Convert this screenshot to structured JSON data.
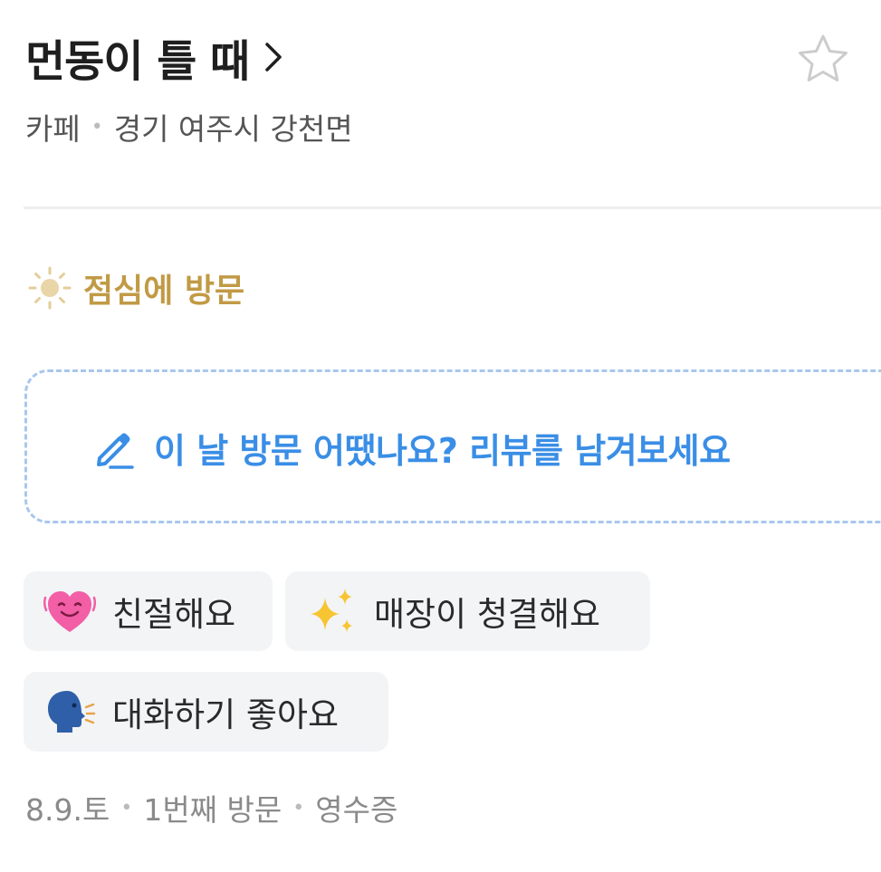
{
  "place": {
    "name": "먼동이 틀 때",
    "category": "카페",
    "address": "경기 여주시 강천면"
  },
  "visit": {
    "time_label": "점심에 방문",
    "time_icon": "sun-icon"
  },
  "review_prompt": {
    "text": "이 날 방문 어땠나요? 리뷰를 남겨보세요",
    "icon": "pencil-icon"
  },
  "keywords": [
    {
      "emoji": "smiling-heart-icon",
      "label": "친절해요"
    },
    {
      "emoji": "sparkles-icon",
      "label": "매장이 청결해요"
    },
    {
      "emoji": "speaking-head-icon",
      "label": "대화하기 좋아요"
    }
  ],
  "meta": {
    "date": "8.9.토",
    "visit_count": "1번째 방문",
    "verification": "영수증"
  },
  "colors": {
    "accent_blue": "#3a8ee6",
    "visit_gold": "#c19a45",
    "tag_bg": "#f3f4f6"
  }
}
